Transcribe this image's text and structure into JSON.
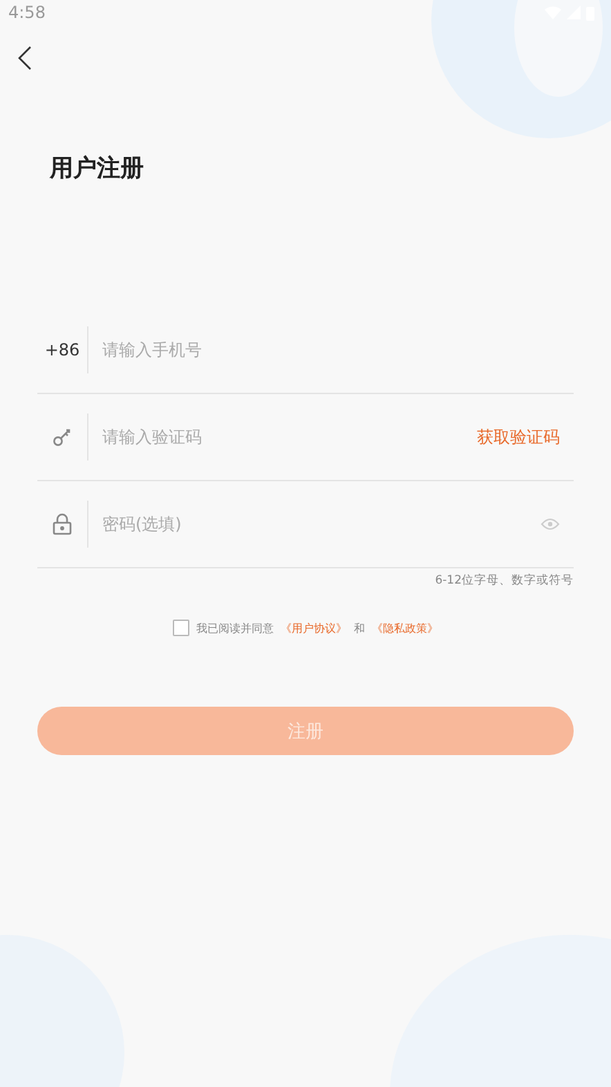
{
  "status_bar": {
    "time": "4:58"
  },
  "title": "用户注册",
  "fields": [
    {
      "kind": "phone",
      "prefix": "+86",
      "placeholder": "请输入手机号"
    },
    {
      "kind": "code",
      "placeholder": "请输入验证码",
      "action": "获取验证码"
    },
    {
      "kind": "password",
      "placeholder": "密码(选填)"
    }
  ],
  "password_hint": "6-12位字母、数字或符号",
  "agreement": {
    "checked": false,
    "text": "我已阅读并同意",
    "terms_link": "《用户协议》",
    "joiner": "和",
    "privacy_link": "《隐私政策》"
  },
  "submit": {
    "label": "注册",
    "disabled": true
  }
}
